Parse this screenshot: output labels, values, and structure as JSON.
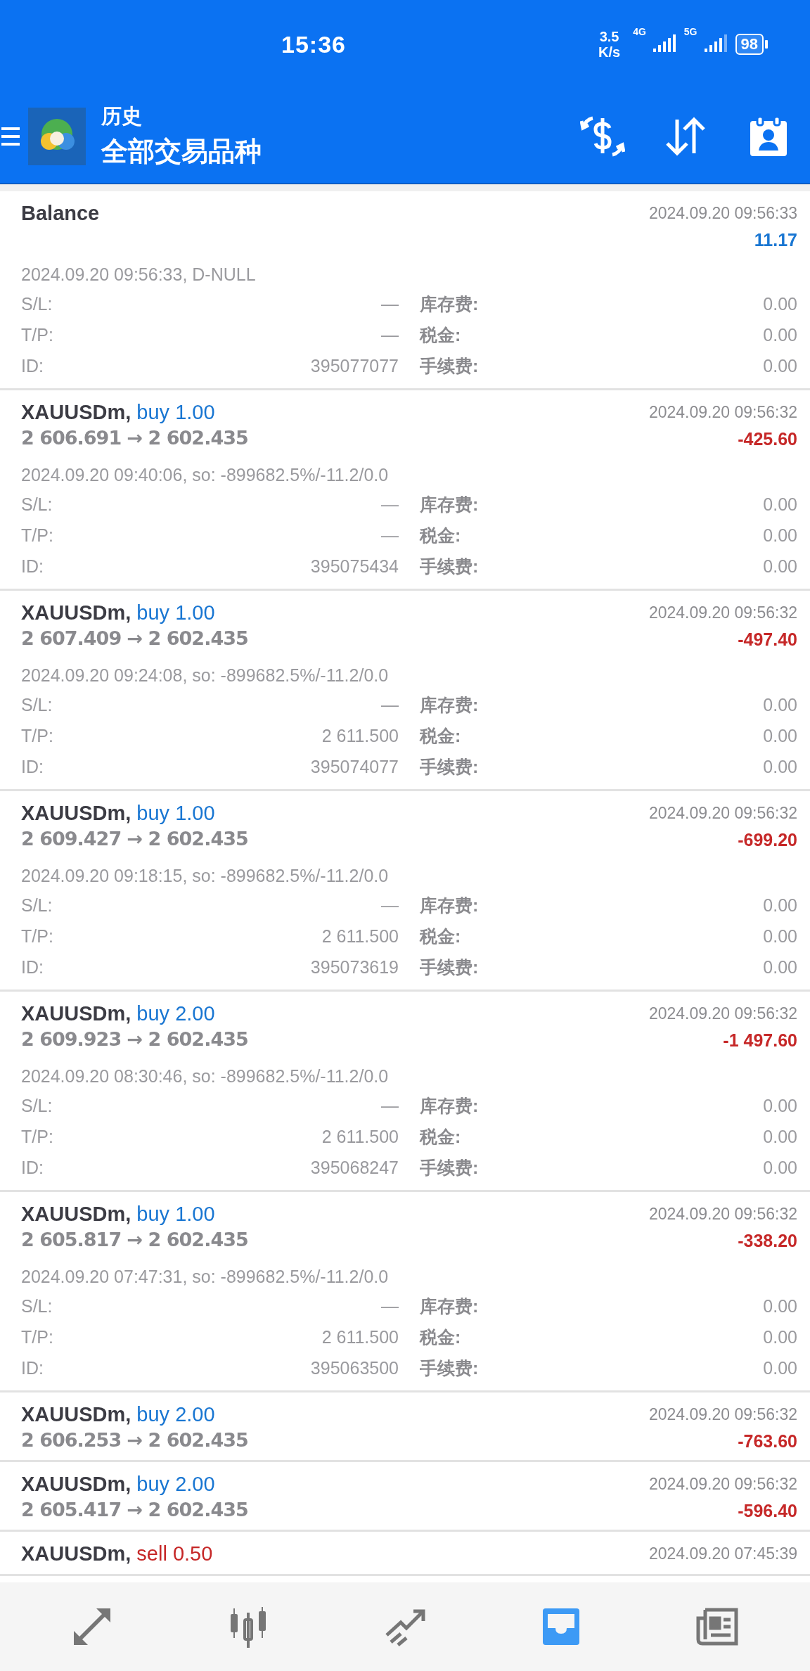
{
  "status_bar": {
    "time": "15:36",
    "speed_value": "3.5",
    "speed_unit": "K/s",
    "network_1": "4G",
    "network_2": "5G",
    "battery": "98"
  },
  "header": {
    "title": "历史",
    "subtitle": "全部交易品种"
  },
  "deals": [
    {
      "title": "Balance",
      "time": "2024.09.20 09:56:33",
      "profit": {
        "text": "11.17",
        "color": "#1976d2"
      },
      "comment": "2024.09.20 09:56:33, D-NULL",
      "fields": [
        {
          "label": "S/L:",
          "value": "—"
        },
        {
          "label": "库存费:",
          "value": "0.00"
        },
        {
          "label": "T/P:",
          "value": "—"
        },
        {
          "label": "税金:",
          "value": "0.00"
        },
        {
          "label": "ID:",
          "value": "395077077"
        },
        {
          "label": "手续费:",
          "value": "0.00"
        }
      ]
    },
    {
      "title": "XAUUSDm,",
      "side": {
        "text": "buy 1.00",
        "color": "#1976d2"
      },
      "prices": "2 606.691 → 2 602.435",
      "time": "2024.09.20 09:56:32",
      "profit": {
        "text": "-425.60",
        "color": "#c62828"
      },
      "comment": "2024.09.20 09:40:06, so: -899682.5%/-11.2/0.0",
      "fields": [
        {
          "label": "S/L:",
          "value": "—"
        },
        {
          "label": "库存费:",
          "value": "0.00"
        },
        {
          "label": "T/P:",
          "value": "—"
        },
        {
          "label": "税金:",
          "value": "0.00"
        },
        {
          "label": "ID:",
          "value": "395075434"
        },
        {
          "label": "手续费:",
          "value": "0.00"
        }
      ]
    },
    {
      "title": "XAUUSDm,",
      "side": {
        "text": "buy 1.00",
        "color": "#1976d2"
      },
      "prices": "2 607.409 → 2 602.435",
      "time": "2024.09.20 09:56:32",
      "profit": {
        "text": "-497.40",
        "color": "#c62828"
      },
      "comment": "2024.09.20 09:24:08, so: -899682.5%/-11.2/0.0",
      "fields": [
        {
          "label": "S/L:",
          "value": "—"
        },
        {
          "label": "库存费:",
          "value": "0.00"
        },
        {
          "label": "T/P:",
          "value": "2 611.500"
        },
        {
          "label": "税金:",
          "value": "0.00"
        },
        {
          "label": "ID:",
          "value": "395074077"
        },
        {
          "label": "手续费:",
          "value": "0.00"
        }
      ]
    },
    {
      "title": "XAUUSDm,",
      "side": {
        "text": "buy 1.00",
        "color": "#1976d2"
      },
      "prices": "2 609.427 → 2 602.435",
      "time": "2024.09.20 09:56:32",
      "profit": {
        "text": "-699.20",
        "color": "#c62828"
      },
      "comment": "2024.09.20 09:18:15, so: -899682.5%/-11.2/0.0",
      "fields": [
        {
          "label": "S/L:",
          "value": "—"
        },
        {
          "label": "库存费:",
          "value": "0.00"
        },
        {
          "label": "T/P:",
          "value": "2 611.500"
        },
        {
          "label": "税金:",
          "value": "0.00"
        },
        {
          "label": "ID:",
          "value": "395073619"
        },
        {
          "label": "手续费:",
          "value": "0.00"
        }
      ]
    },
    {
      "title": "XAUUSDm,",
      "side": {
        "text": "buy 2.00",
        "color": "#1976d2"
      },
      "prices": "2 609.923 → 2 602.435",
      "time": "2024.09.20 09:56:32",
      "profit": {
        "text": "-1 497.60",
        "color": "#c62828"
      },
      "comment": "2024.09.20 08:30:46, so: -899682.5%/-11.2/0.0",
      "fields": [
        {
          "label": "S/L:",
          "value": "—"
        },
        {
          "label": "库存费:",
          "value": "0.00"
        },
        {
          "label": "T/P:",
          "value": "2 611.500"
        },
        {
          "label": "税金:",
          "value": "0.00"
        },
        {
          "label": "ID:",
          "value": "395068247"
        },
        {
          "label": "手续费:",
          "value": "0.00"
        }
      ]
    },
    {
      "title": "XAUUSDm,",
      "side": {
        "text": "buy 1.00",
        "color": "#1976d2"
      },
      "prices": "2 605.817 → 2 602.435",
      "time": "2024.09.20 09:56:32",
      "profit": {
        "text": "-338.20",
        "color": "#c62828"
      },
      "comment": "2024.09.20 07:47:31, so: -899682.5%/-11.2/0.0",
      "fields": [
        {
          "label": "S/L:",
          "value": "—"
        },
        {
          "label": "库存费:",
          "value": "0.00"
        },
        {
          "label": "T/P:",
          "value": "2 611.500"
        },
        {
          "label": "税金:",
          "value": "0.00"
        },
        {
          "label": "ID:",
          "value": "395063500"
        },
        {
          "label": "手续费:",
          "value": "0.00"
        }
      ]
    },
    {
      "title": "XAUUSDm,",
      "side": {
        "text": "buy 2.00",
        "color": "#1976d2"
      },
      "prices": "2 606.253 → 2 602.435",
      "time": "2024.09.20 09:56:32",
      "profit": {
        "text": "-763.60",
        "color": "#c62828"
      }
    },
    {
      "title": "XAUUSDm,",
      "side": {
        "text": "buy 2.00",
        "color": "#1976d2"
      },
      "prices": "2 605.417 → 2 602.435",
      "time": "2024.09.20 09:56:32",
      "profit": {
        "text": "-596.40",
        "color": "#c62828"
      }
    },
    {
      "title": "XAUUSDm,",
      "side": {
        "text": "sell 0.50",
        "color": "#c62828"
      },
      "time": "2024.09.20 07:45:39"
    }
  ],
  "nav": [
    {
      "kind": "trade",
      "selected": false
    },
    {
      "kind": "quotes",
      "selected": false
    },
    {
      "kind": "chart",
      "selected": false
    },
    {
      "kind": "history",
      "selected": true
    },
    {
      "kind": "news",
      "selected": false
    }
  ]
}
